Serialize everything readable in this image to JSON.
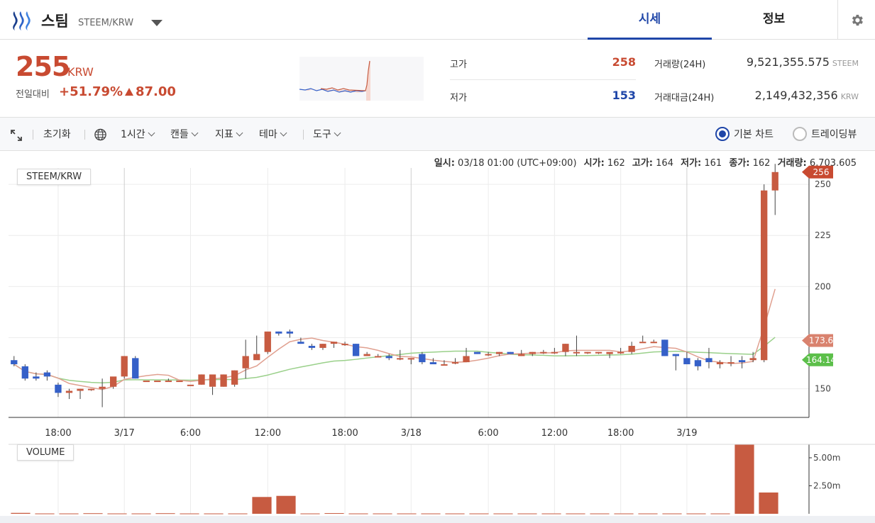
{
  "header": {
    "coin_name": "스팀",
    "coin_pair": "STEEM/KRW",
    "tab_price": "시세",
    "tab_info": "정보"
  },
  "summary": {
    "price": "255",
    "price_unit": "KRW",
    "change_label": "전일대비",
    "change_pct": "+51.79%",
    "change_amt": "87.00",
    "high_label": "고가",
    "high_value": "258",
    "low_label": "저가",
    "low_value": "153",
    "volume_label": "거래량(24H)",
    "volume_value": "9,521,355.575",
    "volume_unit": "STEEM",
    "amount_label": "거래대금(24H)",
    "amount_value": "2,149,432,356",
    "amount_unit": "KRW",
    "colors": {
      "up": "#c84a31",
      "down": "#1f46a8"
    }
  },
  "toolbar": {
    "reset_label": "초기화",
    "interval_label": "1시간",
    "candle_label": "캔들",
    "indicator_label": "지표",
    "theme_label": "테마",
    "tools_label": "도구",
    "basic_chart_label": "기본 차트",
    "tradingview_label": "트레이딩뷰"
  },
  "ohlc": {
    "date_label": "일시:",
    "date_value": "03/18 01:00 (UTC+09:00)",
    "open_label": "시가:",
    "open_value": "162",
    "high_label": "고가:",
    "high_value": "164",
    "low_label": "저가:",
    "low_value": "161",
    "close_label": "종가:",
    "close_value": "162",
    "volume_label": "거래량:",
    "volume_value": "6,703.605"
  },
  "chart_data": {
    "type": "candlestick",
    "series_label": "STEEM/KRW",
    "volume_label": "VOLUME",
    "x_tick_labels": [
      "18:00",
      "3/17",
      "6:00",
      "12:00",
      "18:00",
      "3/18",
      "6:00",
      "12:00",
      "18:00",
      "3/19"
    ],
    "y_ticks": [
      150,
      175,
      200,
      225,
      250
    ],
    "y_tick_labels": [
      "150",
      "",
      "200",
      "225",
      "250"
    ],
    "ylim": [
      136,
      258
    ],
    "volume_ticks_labels": [
      "5.00m",
      "2.50m"
    ],
    "price_tags": {
      "last": "256",
      "ma_fast": "173.6",
      "ma_slow": "164.14"
    },
    "colors": {
      "up": "#c75b41",
      "down": "#3560c8",
      "ma_fast": "#e0a090",
      "ma_slow": "#9ad08a"
    },
    "candles": [
      [
        164,
        166,
        161,
        162
      ],
      [
        161,
        162,
        154,
        155
      ],
      [
        156,
        158,
        154,
        155
      ],
      [
        158,
        159,
        154,
        156
      ],
      [
        152,
        153,
        146,
        148
      ],
      [
        148,
        150,
        145,
        149
      ],
      [
        149,
        150,
        145,
        150
      ],
      [
        150,
        150,
        149,
        150
      ],
      [
        150,
        155,
        141,
        151
      ],
      [
        151,
        154,
        150,
        156
      ],
      [
        156,
        166,
        155,
        166
      ],
      [
        165,
        166,
        155,
        155
      ],
      [
        154,
        154,
        154,
        154
      ],
      [
        154,
        154,
        154,
        154
      ],
      [
        154,
        155,
        154,
        154
      ],
      [
        154,
        154,
        154,
        154
      ],
      [
        152,
        152,
        152,
        152
      ],
      [
        152,
        157,
        152,
        157
      ],
      [
        151,
        151,
        147,
        157
      ],
      [
        151,
        157,
        151,
        157
      ],
      [
        152,
        159,
        151,
        159
      ],
      [
        160,
        174,
        155,
        166
      ],
      [
        164,
        176,
        165,
        167
      ],
      [
        168,
        175,
        167,
        178
      ],
      [
        178,
        178,
        176,
        177
      ],
      [
        178,
        179,
        175,
        177
      ],
      [
        173,
        175,
        172,
        172
      ],
      [
        171,
        172,
        169,
        170
      ],
      [
        170,
        172,
        169,
        172
      ],
      [
        172,
        173,
        170,
        173
      ],
      [
        172,
        173,
        171,
        172
      ],
      [
        172,
        172,
        169,
        166
      ],
      [
        166,
        168,
        166,
        167
      ],
      [
        166,
        167,
        166,
        166
      ],
      [
        166,
        167,
        164,
        165
      ],
      [
        165,
        169,
        164,
        165
      ],
      [
        165,
        165,
        162,
        165
      ],
      [
        167,
        168,
        162,
        163
      ],
      [
        163,
        165,
        162,
        162
      ],
      [
        162,
        164,
        162,
        162
      ],
      [
        163,
        165,
        162,
        163
      ],
      [
        163,
        170,
        163,
        166
      ],
      [
        168,
        168,
        167,
        167
      ],
      [
        167,
        168,
        166,
        167
      ],
      [
        167,
        168,
        166,
        168
      ],
      [
        168,
        168,
        167,
        167
      ],
      [
        166,
        169,
        166,
        167
      ],
      [
        167,
        168,
        166,
        168
      ],
      [
        168,
        169,
        167,
        168
      ],
      [
        168,
        170,
        167,
        168
      ],
      [
        168,
        172,
        166,
        172
      ],
      [
        168,
        176,
        166,
        168
      ],
      [
        168,
        168,
        167,
        168
      ],
      [
        168,
        168,
        167,
        168
      ],
      [
        167,
        167,
        165,
        168
      ],
      [
        168,
        170,
        167,
        168
      ],
      [
        168,
        173,
        167,
        171
      ],
      [
        173,
        176,
        173,
        173
      ],
      [
        173,
        174,
        173,
        173
      ],
      [
        174,
        174,
        166,
        166
      ],
      [
        167,
        167,
        159,
        166
      ],
      [
        165,
        168,
        163,
        162
      ],
      [
        164,
        165,
        159,
        161
      ],
      [
        165,
        170,
        160,
        163
      ],
      [
        162,
        164,
        160,
        163
      ],
      [
        163,
        166,
        161,
        163
      ],
      [
        164,
        166,
        160,
        163
      ],
      [
        164,
        168,
        163,
        165
      ],
      [
        164,
        250,
        163,
        247
      ],
      [
        247,
        260,
        235,
        256
      ]
    ],
    "volume": [
      0.08,
      0.03,
      0.03,
      0.05,
      0.03,
      0.03,
      0.05,
      0.03,
      0.03,
      0.03,
      1.5,
      1.6,
      0.03,
      0.06,
      0.03,
      0.03,
      0.03,
      0.03,
      0.03,
      0.03,
      0.03,
      0.03,
      0.03,
      0.03,
      0.03,
      0.03,
      0.03,
      0.03,
      0.03,
      0.03,
      6.2,
      1.9
    ]
  }
}
